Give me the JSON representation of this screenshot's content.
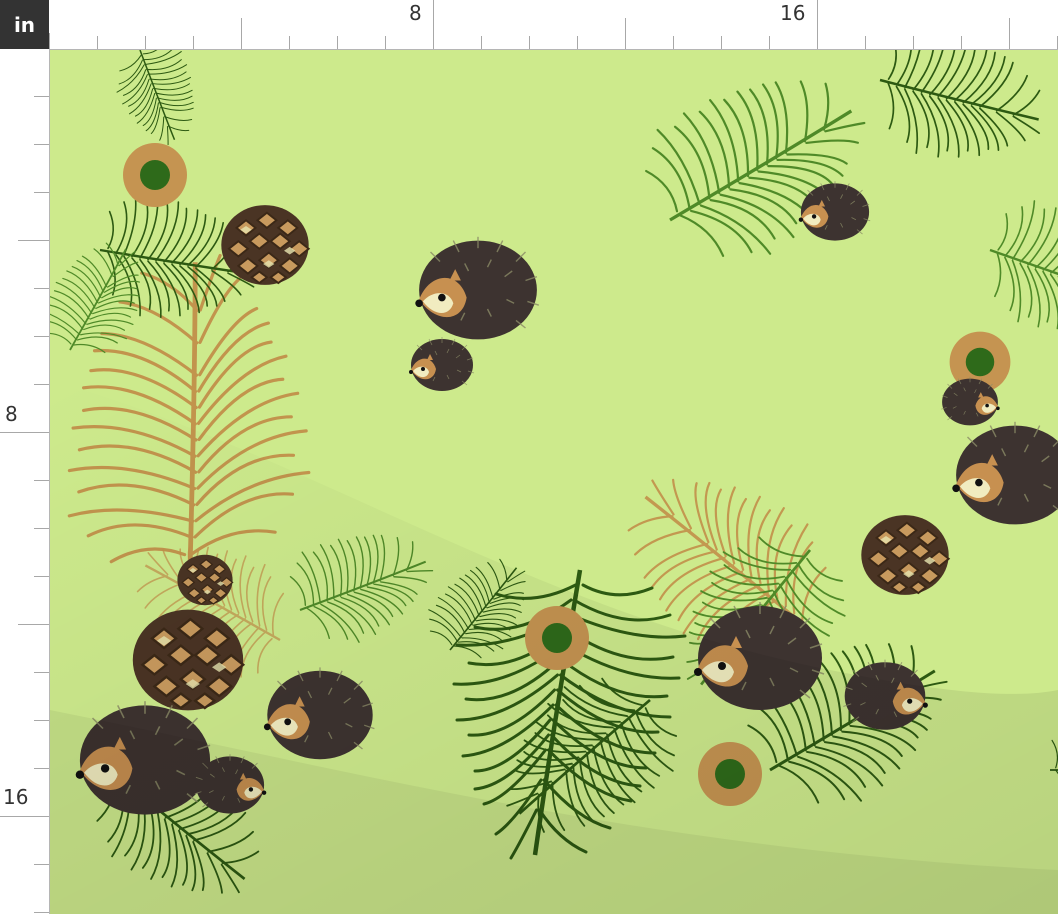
{
  "ruler": {
    "unit": "in",
    "top_labels": [
      "8",
      "16"
    ],
    "left_labels": [
      "8",
      "16"
    ]
  },
  "pattern": {
    "motifs": [
      "hedgehog",
      "pine-branch",
      "pine-cone",
      "dot"
    ],
    "colors": {
      "background": "#cdea8c",
      "branch_green": "#2d5a12",
      "branch_light": "#4f8a28",
      "branch_gold": "#c2904a",
      "cone": "#6b4a30",
      "hedgehog_body": "#3d3330",
      "hedgehog_face": "#c79050",
      "dot_ring": "#c59451",
      "dot_center": "#2e6a1a"
    }
  }
}
